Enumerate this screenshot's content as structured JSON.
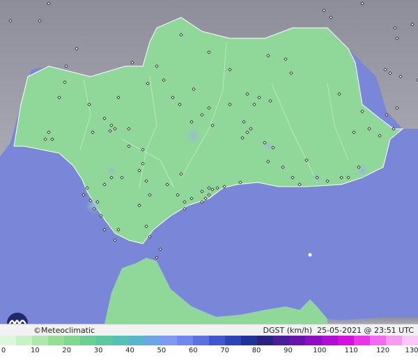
{
  "brand": {
    "credit": "©Meteoclimatic"
  },
  "map": {
    "variable": "DGST",
    "unit": "(km/h)",
    "date": "25-05-2021",
    "at": "@",
    "time": "23:51 UTC",
    "colors": {
      "sea": "#7a86d8",
      "land_outside": "#9a9aa6",
      "land_region": "#8fd89a",
      "border": "#ffffff"
    }
  },
  "legend": {
    "ticks": [
      "0",
      "10",
      "20",
      "30",
      "40",
      "50",
      "60",
      "70",
      "80",
      "90",
      "100",
      "110",
      "120",
      "130"
    ],
    "colors": [
      "#dcf7dc",
      "#c6f2c6",
      "#ade9ad",
      "#93e093",
      "#7ed88e",
      "#6ccf93",
      "#5fc7a0",
      "#57bfb5",
      "#5ab3cf",
      "#6aa6e6",
      "#7b9af0",
      "#6f87ee",
      "#5a71e0",
      "#3f57cf",
      "#2b44b8",
      "#1f3296",
      "#2a2280",
      "#4a1c96",
      "#6a12ab",
      "#8c0fc0",
      "#b00ed4",
      "#d40fe0",
      "#ea36e8",
      "#f26bee",
      "#f79af3",
      "#fbc7f8"
    ]
  }
}
